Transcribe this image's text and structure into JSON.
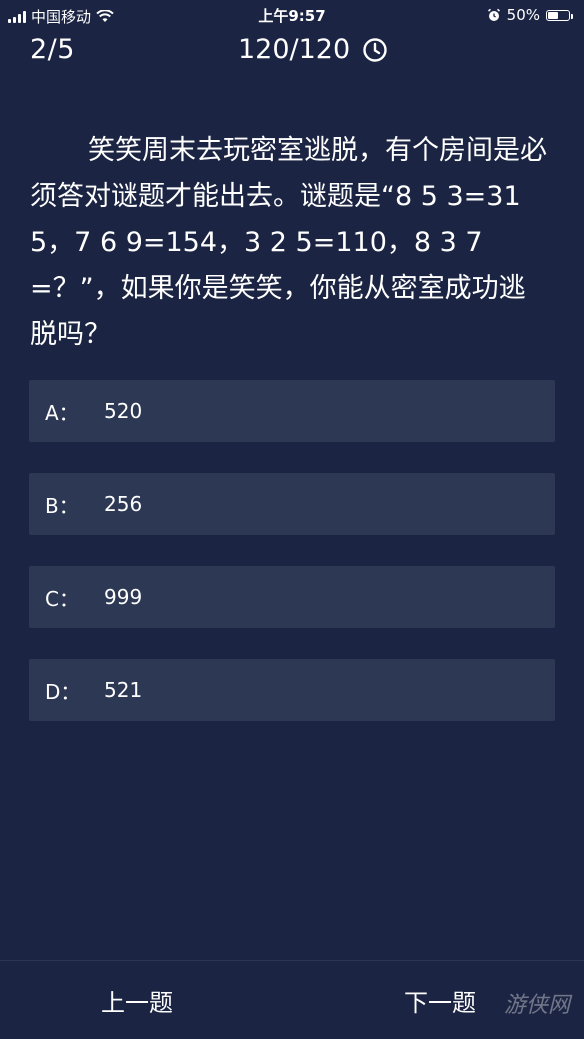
{
  "status_bar": {
    "carrier": "中国移动",
    "time": "上午9:57",
    "battery": "50%",
    "battery_level": 0.5
  },
  "header": {
    "progress": "2/5",
    "timer": "120/120"
  },
  "question": {
    "text": "笑笑周末去玩密室逃脱，有个房间是必须答对谜题才能出去。谜题是“8 5 3=315，7 6 9=154，3 2 5=110，8 3 7=？”，如果你是笑笑，你能从密室成功逃脱吗？"
  },
  "options": [
    {
      "letter": "A：",
      "text": "520"
    },
    {
      "letter": "B：",
      "text": "256"
    },
    {
      "letter": "C：",
      "text": "999"
    },
    {
      "letter": "D：",
      "text": "521"
    }
  ],
  "footer": {
    "prev_label": "上一题",
    "next_label": "下一题",
    "watermark": "游侠网"
  }
}
